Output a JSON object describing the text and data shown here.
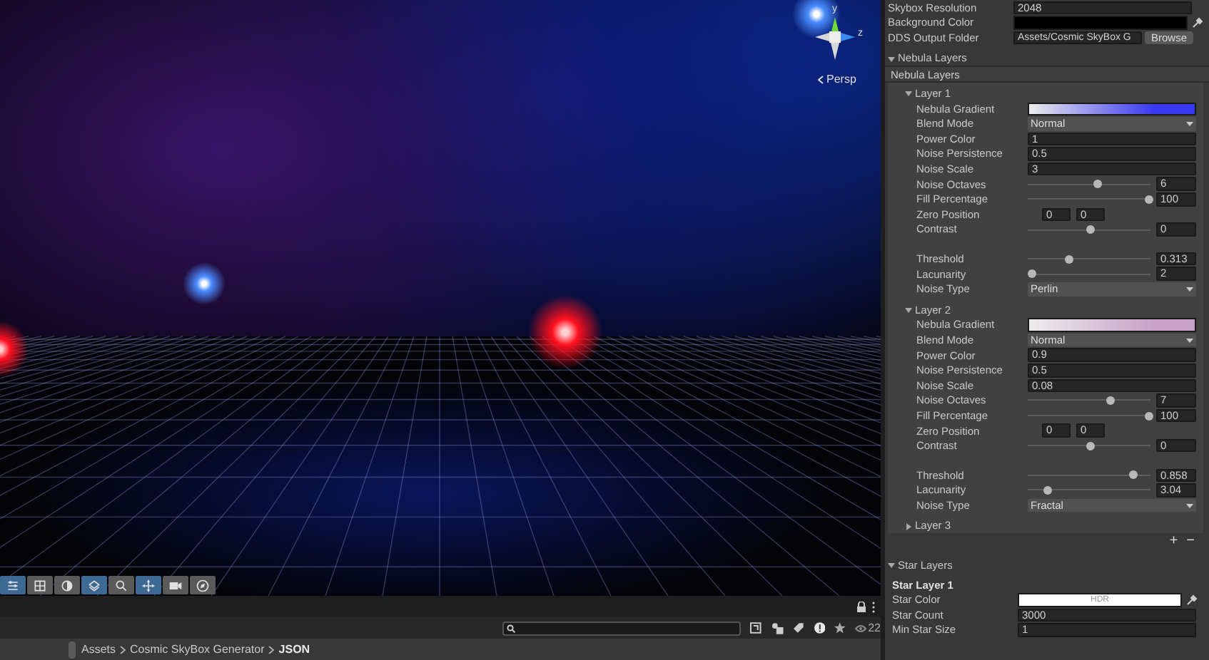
{
  "scene": {
    "view_label": "Persp",
    "axes": [
      "y",
      "z"
    ],
    "tools": [
      {
        "selected": true
      },
      {
        "selected": false
      },
      {
        "selected": false
      },
      {
        "selected": true
      },
      {
        "selected": false
      },
      {
        "selected": true
      },
      {
        "selected": false
      },
      {
        "selected": false
      }
    ]
  },
  "project_bar": {
    "hidden_count": "22",
    "breadcrumb": [
      "Assets",
      "Cosmic SkyBox Generator",
      "JSON"
    ]
  },
  "inspector": {
    "top_fields": [
      {
        "kind": "text",
        "label": "Skybox Resolution",
        "value": "2048"
      },
      {
        "kind": "color",
        "label": "Background Color",
        "color": "#000000"
      },
      {
        "kind": "folder",
        "label": "DDS Output Folder",
        "value": "Assets/Cosmic SkyBox G",
        "button": "Browse"
      }
    ],
    "nebula": {
      "label": "Nebula Layers",
      "expanded": true,
      "list_header": "Nebula Layers",
      "add": "+",
      "remove": "−",
      "layers": [
        {
          "label": "Layer 1",
          "expanded": true,
          "field_groups": [
            [
              {
                "kind": "gradient",
                "label": "Nebula Gradient",
                "color": "#3a3af0"
              },
              {
                "kind": "dropdown",
                "label": "Blend Mode",
                "value": "Normal"
              },
              {
                "kind": "text",
                "label": "Power Color",
                "value": "1"
              },
              {
                "kind": "text",
                "label": "Noise Persistence",
                "value": "0.5"
              },
              {
                "kind": "text",
                "label": "Noise Scale",
                "value": "3"
              },
              {
                "kind": "slider",
                "label": "Noise Octaves",
                "level": 0.57,
                "value": "6"
              },
              {
                "kind": "slider",
                "label": "Fill Percentage",
                "level": 0.99,
                "value": "100"
              },
              {
                "kind": "pair",
                "label": "Zero Position",
                "values": [
                  "0",
                  "0"
                ]
              },
              {
                "kind": "slider",
                "label": "Contrast",
                "level": 0.51,
                "value": "0"
              }
            ],
            [
              {
                "kind": "slider",
                "label": "Threshold",
                "level": 0.34,
                "value": "0.313"
              },
              {
                "kind": "slider",
                "label": "Lacunarity",
                "level": 0.03,
                "value": "2"
              },
              {
                "kind": "dropdown",
                "label": "Noise Type",
                "value": "Perlin"
              }
            ]
          ]
        },
        {
          "label": "Layer 2",
          "expanded": true,
          "field_groups": [
            [
              {
                "kind": "gradient",
                "label": "Nebula Gradient",
                "color": "#c9a0c9"
              },
              {
                "kind": "dropdown",
                "label": "Blend Mode",
                "value": "Normal"
              },
              {
                "kind": "text",
                "label": "Power Color",
                "value": "0.9"
              },
              {
                "kind": "text",
                "label": "Noise Persistence",
                "value": "0.5"
              },
              {
                "kind": "text",
                "label": "Noise Scale",
                "value": "0.08"
              },
              {
                "kind": "slider",
                "label": "Noise Octaves",
                "level": 0.67,
                "value": "7"
              },
              {
                "kind": "slider",
                "label": "Fill Percentage",
                "level": 0.99,
                "value": "100"
              },
              {
                "kind": "pair",
                "label": "Zero Position",
                "values": [
                  "0",
                  "0"
                ]
              },
              {
                "kind": "slider",
                "label": "Contrast",
                "level": 0.51,
                "value": "0"
              }
            ],
            [
              {
                "kind": "slider",
                "label": "Threshold",
                "level": 0.86,
                "value": "0.858"
              },
              {
                "kind": "slider",
                "label": "Lacunarity",
                "level": 0.16,
                "value": "3.04"
              },
              {
                "kind": "dropdown",
                "label": "Noise Type",
                "value": "Fractal"
              }
            ]
          ]
        },
        {
          "label": "Layer 3",
          "expanded": false
        }
      ]
    },
    "stars": {
      "label": "Star Layers",
      "expanded": true,
      "layers": [
        {
          "label": "Star Layer 1",
          "fields": [
            {
              "kind": "hdr_color",
              "label": "Star Color",
              "value": "HDR",
              "color": "#ffffff"
            },
            {
              "kind": "text",
              "label": "Star Count",
              "value": "3000"
            },
            {
              "kind": "text",
              "label": "Min Star Size",
              "value": "1"
            }
          ]
        }
      ]
    }
  }
}
